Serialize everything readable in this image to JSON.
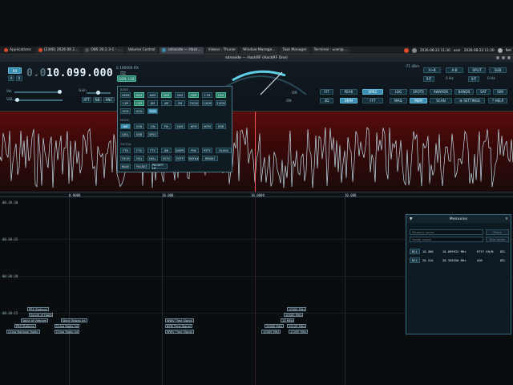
{
  "taskbar": {
    "items": [
      {
        "label": "Applications"
      },
      {
        "label": "(2346) 2026 08 2..."
      },
      {
        "label": "OBS 30.2.3-1 - ..."
      },
      {
        "label": "Volume Control"
      },
      {
        "label": "sdrooide — Hack..."
      },
      {
        "label": "Videos - Thunar"
      },
      {
        "label": "Window Manage..."
      },
      {
        "label": "Task Manager"
      },
      {
        "label": "Terminal - user@..."
      }
    ],
    "clock1": "2026-08-23 11:30",
    "user": "user",
    "clock2": "2026-08-23 11:30",
    "net": "Net"
  },
  "window": {
    "title": "sdrooide — HackRF (HackRF One)"
  },
  "panel": {
    "rx": "RX",
    "freq_dim": "0.0",
    "freq": "10.099.000",
    "freq_unit": "≈",
    "meter_lbl": "S 100000 RX",
    "gen_lsb": "GEN: LSB",
    "vol": "Vol",
    "gain": "Gain",
    "sql": "SQL",
    "ag": "AG",
    "att": "ATT",
    "btn_nb": "NB",
    "btn_anc": "ANC",
    "btn_a": "A",
    "on1": "ON",
    "on2": "ON",
    "on3": "ON",
    "btn_fit": "FIT",
    "btn_peak": "PEAK",
    "btn_spec": "SPEC",
    "btn_3d": "3D",
    "btn_skim": "SKIM",
    "btn_fft": "FFT",
    "btn_log": "LOG",
    "btn_spots": "SPOTS",
    "btn_awards": "AWARDS",
    "btn_bands": "BANDS",
    "btn_sat": "SAT",
    "btn_ism": "ISM",
    "btn_mail": "MAIL",
    "btn_mem": "MEM",
    "btn_scan": "SCAN",
    "btn_settings": "⚙ SETTINGS",
    "btn_help": "? HELP",
    "btn_ab": "A>B",
    "btn_ab2": "A-B",
    "btn_split": "SPLIT",
    "btn_sub": "SUB",
    "rit": "RIT",
    "rit_val": "0 Hz",
    "xit": "XIT",
    "xit_val": "0 Hz",
    "s_db": "-71 dBm"
  },
  "bands": {
    "section_band": "BAND",
    "row1": [
      "160M",
      "80M",
      "60M",
      "40M",
      "30M",
      "20M",
      "17M",
      "15M"
    ],
    "row2": [
      "12M",
      "10M",
      "6M",
      "4M",
      "2M",
      "70CM",
      "23CM",
      "13CM"
    ],
    "row3": [
      "9CM",
      "6CM",
      "3CM"
    ],
    "section_mode": "MODE",
    "row4": [
      "AM",
      "USB",
      "CW",
      "FM",
      "SAM",
      "NFM",
      "WFM",
      "DSB"
    ],
    "row5": [
      "DIGL",
      "DSB",
      "SPEC"
    ],
    "section_digi": "DIGITAL",
    "row6": [
      "FT8",
      "FT4",
      "FT2",
      "JS8",
      "WSPR",
      "PSK",
      "RTTY",
      "OLIVIA"
    ],
    "row7": [
      "THOR",
      "FSQ",
      "HELL",
      "SSTV",
      "RFFP",
      "WEFAX",
      "RPAINT"
    ],
    "row8": [
      "RADE",
      "PACKET",
      "PACKET-HF"
    ]
  },
  "scale": {
    "labels": [
      "0.0000",
      "10.000",
      "10.0000",
      "10.000"
    ]
  },
  "waterfall": {
    "times": [
      "00:30:30",
      "00:30:25",
      "00:30:20",
      "00:30:15"
    ],
    "spots_left": [
      "PRS Stations",
      "Sound of Hope",
      "Voice of Vietnam",
      "PRS Stations",
      "China National Radio",
      "China Radio Int",
      "China Radio Int",
      "Voice Taiwan Int"
    ],
    "spots_mid": [
      "WWV Time Signal",
      "BPM Time Signal",
      "WWV Time Signal"
    ],
    "spots_right": [
      "10000 MHz",
      "10000 MHz",
      "10 MHz",
      "10000 MHz",
      "10120 MHz",
      "10000 MHz",
      "11000 MHz"
    ]
  },
  "memories": {
    "title": "Memories",
    "name_ph": "Memory name",
    "folder_ph": "Folder name",
    "share": "Share",
    "new_folder": "New folder",
    "rows": [
      {
        "rcl": "RCL",
        "name": "10.300",
        "freq": "10.099932 MHz",
        "mode": "RTTY 50/N",
        "del": "DEL"
      },
      {
        "rcl": "RCL",
        "name": "28.310",
        "freq": "28.350350 MHz",
        "mode": "USB",
        "del": "DEL"
      }
    ]
  },
  "colors": {
    "accent": "#3a8fb3",
    "spectrum_bg": "#5a0d0d",
    "trace": "#bfe0ec"
  }
}
